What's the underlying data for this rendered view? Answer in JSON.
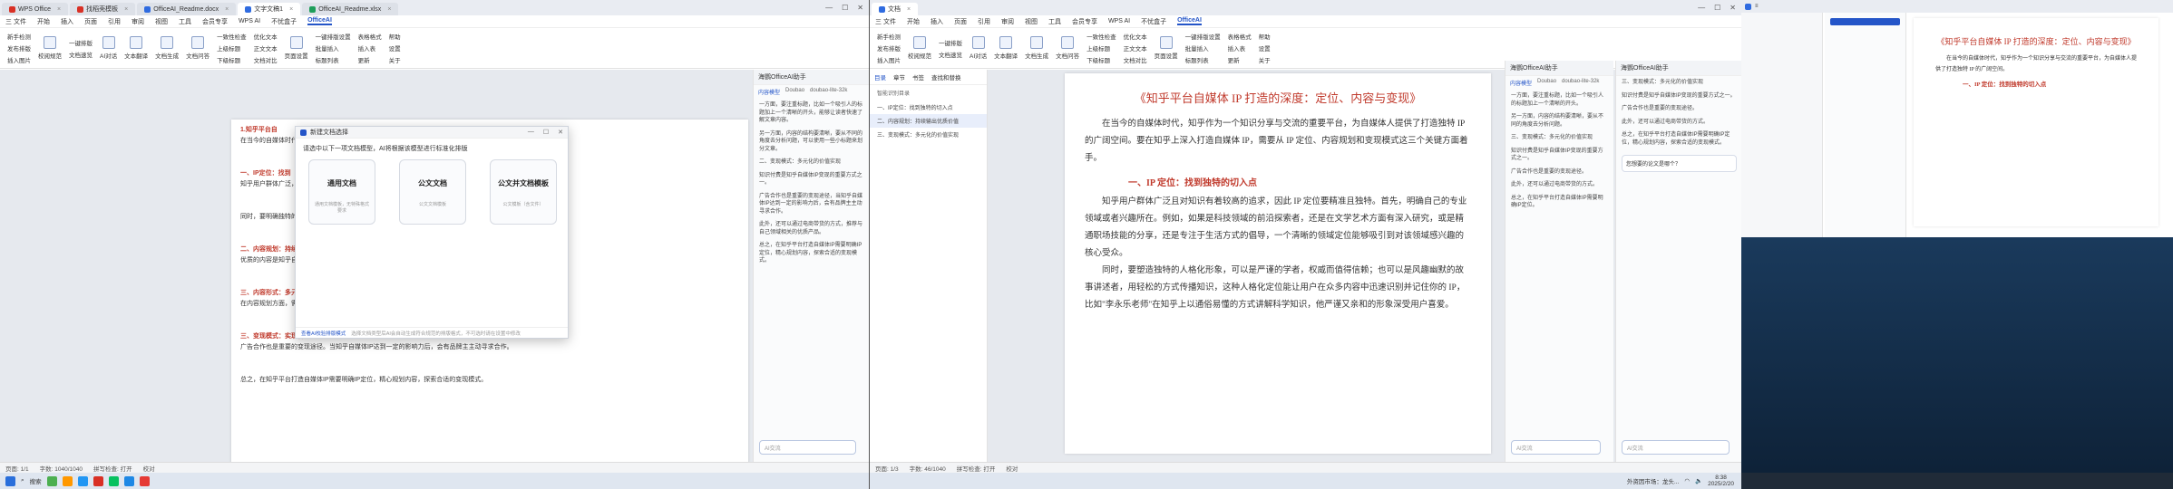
{
  "screen1": {
    "tabs": [
      {
        "label": "WPS Office",
        "color": "#d93025"
      },
      {
        "label": "找稻壳模板",
        "color": "#d93025"
      },
      {
        "label": "OfficeAI_Readme.docx",
        "color": "#2f6be0"
      },
      {
        "label": "文字文稿1",
        "color": "#2f6be0",
        "active": true
      },
      {
        "label": "OfficeAI_Readme.xlsx",
        "color": "#1e9e5a"
      }
    ],
    "menus": [
      "三 文件",
      "开始",
      "插入",
      "页面",
      "引用",
      "审阅",
      "视图",
      "工具",
      "会员专享",
      "WPS AI",
      "不忧盒子",
      "OfficeAI"
    ],
    "active_menu": "OfficeAI",
    "ribbon": {
      "col1": [
        "新手检测",
        "发布排版",
        "插入图片"
      ],
      "big1": "校阅规范",
      "col2": [
        "一键排版",
        "文档速览"
      ],
      "big2": [
        "AI对话",
        "文本翻译",
        "文档生成",
        "文档问答"
      ],
      "col3": [
        "一致性检查",
        "上级标题",
        "下级标题"
      ],
      "col4": [
        "优化文本",
        "正文文本",
        "文档对比"
      ],
      "big3": "页面设置",
      "col5": [
        "一键排版设置",
        "批量插入",
        "标题列表"
      ],
      "col6": [
        "表格格式",
        "插入表",
        "更新"
      ],
      "col7": [
        "帮助",
        "设置",
        "关于"
      ]
    },
    "dialog": {
      "title": "新建文档选择",
      "subtitle": "请选中以下一项文档模型，AI将根据该模型进行标准化排版",
      "cards": [
        {
          "title": "通用文档",
          "desc": "通用文档模板，无特殊格式要求"
        },
        {
          "title": "公文文档",
          "desc": "公文文档模板"
        },
        {
          "title": "公文并文档模板",
          "desc": "公文模板（含文件）"
        }
      ],
      "footer_link": "查看AI校验排版模式",
      "footer_note": "选择文档类型后AI会自动生成符合规范的排版格式，不可选时请在设置中修改"
    },
    "doc_text": [
      "1.知乎平台自",
      "在当今的自媒体时代，知乎作为一个知识分享与交流的重要平台，为自媒体人提供了打造独特IP的广阔空间。",
      "一、IP定位：找到",
      "知乎用户群体广泛，因此IP定位需要精准且独特。首先，明确自己的专业领域或者兴趣所在。",
      "同时，要明确独特的人格化形象。可以是严谨的学者，权威而值得信赖。",
      "二、内容规划：持续",
      "优质的内容是知乎自媒体IP的核心。",
      "三、内容形式：多元化的价值",
      "在内容规划方面，需要有系统性和连贯性。可以制定一个内容日历，提前规划好不同时间段要发布的内容主题。",
      "三、变现模式：实现价值",
      "广告合作也是重要的变现途径。当知乎自媒体IP达到一定的影响力后，会有品牌主主动寻求合作。",
      "总之，在知乎平台打造自媒体IP需要明确IP定位，精心规划内容，探索合适的变现模式。"
    ],
    "side_panel_title": "海鹦OfficeAI助手",
    "side_panel_tabs": [
      "内容模型",
      "Doubao",
      "doubao-lite-32k"
    ],
    "chat": [
      "一方面，要注重标题，比如一个吸引人的标题加上一个清晰的开头，能够让读者快速了解文章内容。",
      "另一方面，内容的结构要清晰，要从不同的角度去分析问题，可以使用一些小标题来划分文章。",
      "二、变现模式：多元化的价值实现",
      "知识付费是知乎自媒体IP变现的重要方式之一。",
      "广告合作也是重要的变现途径，当知乎自媒体IP达到一定的影响力后，会有品牌主主动寻求合作。",
      "此外，还可以通过电商带货的方式，推荐与自己领域相关的优质产品。",
      "总之，在知乎平台打造自媒体IP需要明确IP定位，精心规划内容，探索合适的变现模式。"
    ],
    "input_placeholder": "AI交流",
    "status": [
      "页面: 1/1",
      "字数: 1040/1040",
      "拼写检查: 打开",
      "校对"
    ],
    "taskbar": {
      "search": "搜索"
    }
  },
  "screen2": {
    "tabs": [
      {
        "label": "文档",
        "color": "#2f6be0",
        "active": true
      }
    ],
    "menus": [
      "三 文件",
      "开始",
      "插入",
      "页面",
      "引用",
      "审阅",
      "视图",
      "工具",
      "会员专享",
      "WPS AI",
      "不忧盒子",
      "OfficeAI"
    ],
    "active_menu": "OfficeAI",
    "nav_panel": {
      "tabs": [
        "目录",
        "章节",
        "书签",
        "查找和替换"
      ],
      "smart_label": "智能识别目录",
      "items": [
        "一、IP定位：找到独特的切入点",
        "二、内容规划：持续输出优质价值",
        "三、变现模式：多元化的价值实现"
      ]
    },
    "doc_title": "《知乎平台自媒体 IP 打造的深度：定位、内容与变现》",
    "doc_para1": "在当今的自媒体时代，知乎作为一个知识分享与交流的重要平台，为自媒体人提供了打造独特 IP 的广阔空间。要在知乎上深入打造自媒体 IP，需要从 IP 定位、内容规划和变现模式这三个关键方面着手。",
    "doc_h1": "一、IP 定位：找到独特的切入点",
    "doc_para2": "知乎用户群体广泛且对知识有着较高的追求，因此 IP 定位要精准且独特。首先，明确自己的专业领域或者兴趣所在。例如，如果是科技领域的前沿探索者，还是在文学艺术方面有深入研究，或是精通职场技能的分享，还是专注于生活方式的倡导，一个清晰的领域定位能够吸引到对该领域感兴趣的核心受众。",
    "doc_para3": "同时，要塑造独特的人格化形象，可以是严谨的学者，权威而值得信赖；也可以是风趣幽默的故事讲述者，用轻松的方式传播知识，这种人格化定位能让用户在众多内容中迅速识别并记住你的 IP，比如\"李永乐老师\"在知乎上以通俗易懂的方式讲解科学知识，他严谨又亲和的形象深受用户喜爱。",
    "side_panel_title": "海鹦OfficeAI助手",
    "side_panel_tabs": [
      "内容模型",
      "Doubao",
      "doubao-lite-32k"
    ],
    "chat": [
      "一方面，要注重标题，比如一个吸引人的标题加上一个清晰的开头。",
      "另一方面，内容的结构要清晰，要从不同的角度去分析问题。",
      "三、变现模式：多元化的价值实现",
      "知识付费是知乎自媒体IP变现的重要方式之一。",
      "广告合作也是重要的变现途径。",
      "此外，还可以通过电商带货的方式。",
      "总之，在知乎平台打造自媒体IP需要明确IP定位。"
    ],
    "chat2_title": "海鹦OfficeAI助手",
    "chat2": [
      "三、变现模式：多元化的价值实现",
      "知识付费是知乎自媒体IP变现的重要方式之一。",
      "广告合作也是重要的变现途径。",
      "此外，还可以通过电商带货的方式。",
      "总之，在知乎平台打造自媒体IP需要明确IP定位，精心规划内容，探索合适的变现模式。"
    ],
    "question": "您想要的论文是哪个？",
    "input_placeholder": "AI交流",
    "status": [
      "页面: 1/3",
      "字数: 46/1040",
      "拼写检查: 打开",
      "校对"
    ],
    "taskbar": {
      "weather": "外资因市场：龙头...",
      "time": "8:38",
      "date": "2025/2/20"
    }
  },
  "screen3": {
    "mini_title": "《知乎平台自媒体 IP 打造的深度：定位、内容与变现》",
    "mini_h1": "一、IP 定位：找到独特的切入点",
    "mini_para": "在当今的自媒体时代，知乎作为一个知识分享与交流的重要平台，为自媒体人提供了打造独特 IP 的广阔空间。"
  },
  "colors": {
    "accent": "#2455c8",
    "title_red": "#c0392b",
    "wps_red": "#d93025"
  }
}
